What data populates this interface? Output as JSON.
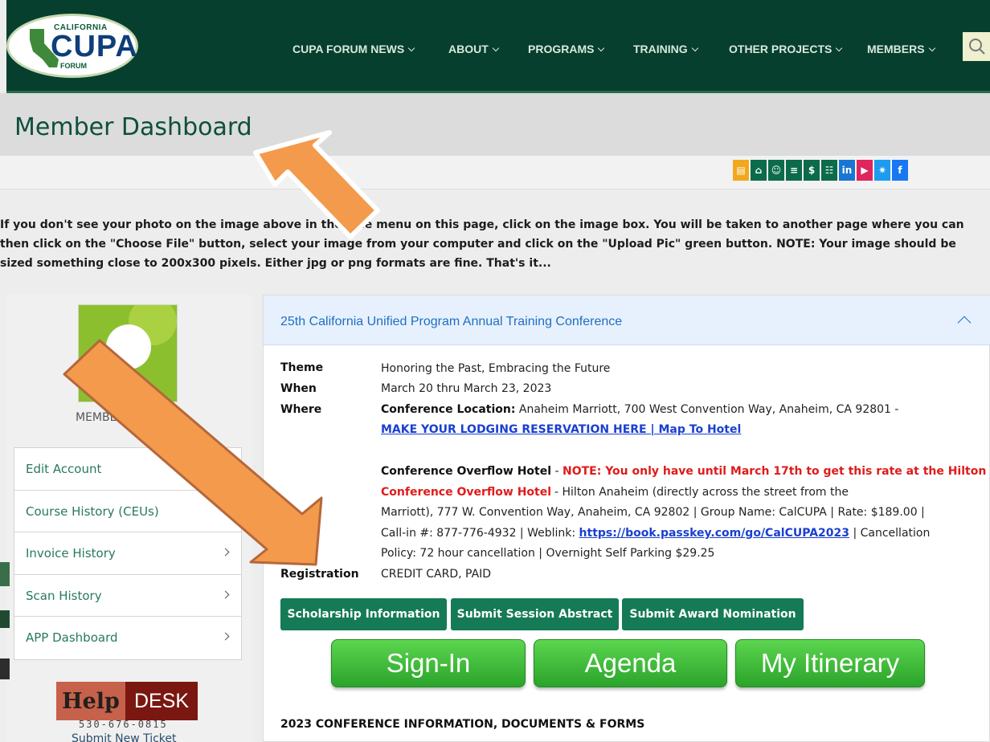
{
  "logo": {
    "top": "CALIFORNIA",
    "main": "CUPA",
    "bottom": "FORUM"
  },
  "nav": {
    "items": [
      "CUPA FORUM NEWS",
      "ABOUT",
      "PROGRAMS",
      "TRAINING",
      "OTHER PROJECTS",
      "MEMBERS"
    ],
    "search_icon": "search-icon"
  },
  "page": {
    "title": "Member Dashboard"
  },
  "social": {
    "icons": [
      "calendar-icon",
      "home-icon",
      "user-icon",
      "list-icon",
      "dollar-icon",
      "cart-icon",
      "linkedin-icon",
      "youtube-icon",
      "twitter-icon",
      "facebook-icon"
    ],
    "colors": [
      "#f2a81d",
      "#0b6b4a",
      "#0b6b4a",
      "#0b6b4a",
      "#0b6b4a",
      "#0b6b4a",
      "#1976d2",
      "#e0245e",
      "#1d9bf0",
      "#1877f2"
    ]
  },
  "instructions": {
    "line1": "If you don't see your photo on the image above in the side menu on this page, click on the image box. You will be taken to another page where you can",
    "line2": "then click on the \"Choose File\" button, select your image from your computer and click on the \"Upload Pic\" green button. NOTE: Your image should be",
    "line3": "sized something close to 200x300 pixels. Either jpg or png formats are fine. That's it..."
  },
  "sidebar": {
    "member_label": "MEMBER",
    "menu": [
      "Edit Account",
      "Course History (CEUs)",
      "Invoice History",
      "Scan History",
      "APP Dashboard"
    ],
    "helpdesk": {
      "help": "Help",
      "desk": "DESK",
      "phone": "530-676-0815",
      "ticket": "Submit New Ticket"
    }
  },
  "conference": {
    "title": "25th California Unified Program Annual Training Conference",
    "theme_label": "Theme",
    "theme": "Honoring the Past, Embracing the Future",
    "when_label": "When",
    "when": "March 20 thru March 23, 2023",
    "where_label": "Where",
    "location_label": "Conference Location:",
    "location": "Anaheim Marriott, 700 West Convention Way, Anaheim, CA 92801 -",
    "lodging_link": "MAKE YOUR LODGING RESERVATION HERE | Map To Hotel",
    "overflow_label": "Conference Overflow Hotel",
    "overflow_note": "NOTE:  You only have until March 17th to get this rate at the Hilton Conference Overflow Hotel",
    "overflow_text1": "Hilton Anaheim (directly across the street from the",
    "overflow_text2": "Marriott), 777 W. Convention Way, Anaheim, CA 92802 | Group Name: CalCUPA | Rate: $189.00 |",
    "overflow_text3a": "Call-in #: 877-776-4932 | Weblink:",
    "weblink": "https://book.passkey.com/go/CalCUPA2023",
    "overflow_text3b": "| Cancellation",
    "overflow_text4": "Policy: 72 hour cancellation | Overnight Self Parking $29.25",
    "registration_label": "Registration",
    "registration": "CREDIT CARD, PAID",
    "buttons": [
      "Scholarship Information",
      "Submit Session Abstract",
      "Submit Award Nomination"
    ],
    "big_buttons": [
      "Sign-In",
      "Agenda",
      "My Itinerary"
    ],
    "docs_heading": "2023 CONFERENCE INFORMATION, DOCUMENTS & FORMS"
  },
  "colors": {
    "header": "#063f2d",
    "accent": "#157a56",
    "arrow": "#f39a4c"
  }
}
